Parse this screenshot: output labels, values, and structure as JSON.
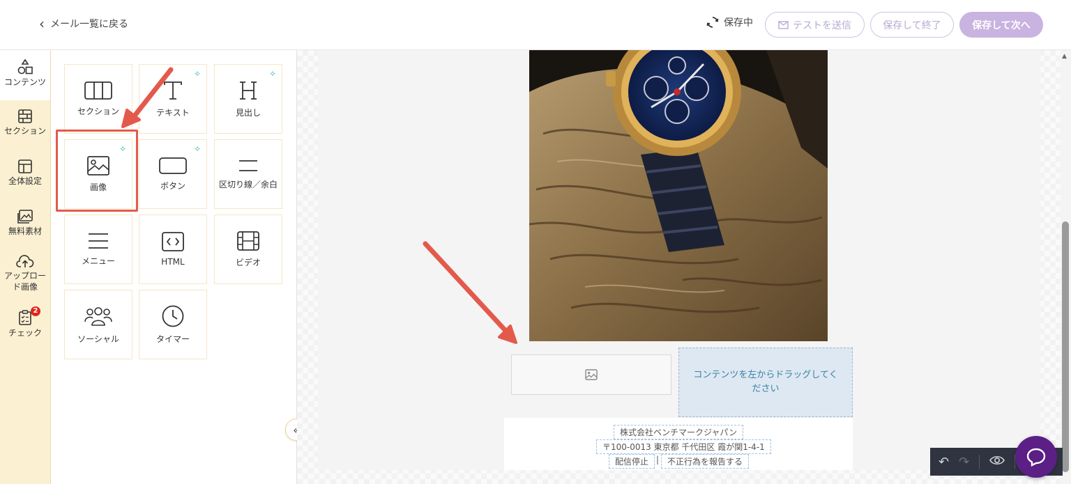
{
  "header": {
    "back_label": "メール一覧に戻る",
    "saving_label": "保存中",
    "test_send_label": "テストを送信",
    "save_exit_label": "保存して終了",
    "save_next_label": "保存して次へ"
  },
  "rail": {
    "items": [
      {
        "label": "コンテンツ",
        "icon": "shapes-icon",
        "active": true
      },
      {
        "label": "セクション",
        "icon": "grid-icon"
      },
      {
        "label": "全体設定",
        "icon": "layout-icon"
      },
      {
        "label": "無料素材",
        "icon": "images-icon"
      },
      {
        "label": "アップロード画像",
        "icon": "cloud-upload-icon"
      },
      {
        "label": "チェック",
        "icon": "checklist-icon",
        "badge": "2"
      }
    ]
  },
  "panel": {
    "tiles": [
      {
        "label": "セクション",
        "icon": "columns-icon"
      },
      {
        "label": "テキスト",
        "icon": "text-icon",
        "ai": true
      },
      {
        "label": "見出し",
        "icon": "heading-icon",
        "ai": true
      },
      {
        "label": "画像",
        "icon": "image-icon",
        "ai": true,
        "highlighted": true
      },
      {
        "label": "ボタン",
        "icon": "button-icon",
        "ai": true
      },
      {
        "label": "区切り線／余白",
        "icon": "divider-icon"
      },
      {
        "label": "メニュー",
        "icon": "menu-icon"
      },
      {
        "label": "HTML",
        "icon": "code-icon"
      },
      {
        "label": "ビデオ",
        "icon": "film-icon"
      },
      {
        "label": "ソーシャル",
        "icon": "users-icon"
      },
      {
        "label": "タイマー",
        "icon": "clock-icon"
      }
    ],
    "collapse_icon": "double-chevron-left-icon"
  },
  "canvas": {
    "dropzone_text": "コンテンツを左からドラッグしてください",
    "footer": {
      "company": "株式会社ベンチマークジャパン",
      "address": "〒100-0013 東京都 千代田区 霞が関1-4-1",
      "unsubscribe": "配信停止",
      "separator": "|",
      "report": "不正行為を報告する"
    }
  },
  "colors": {
    "rail_bg": "#fbf0d2",
    "primary_button": "#c9b3e0",
    "highlight": "#e35a4c",
    "dropzone_bg": "#dde8f2",
    "chat": "#5b1f86"
  }
}
